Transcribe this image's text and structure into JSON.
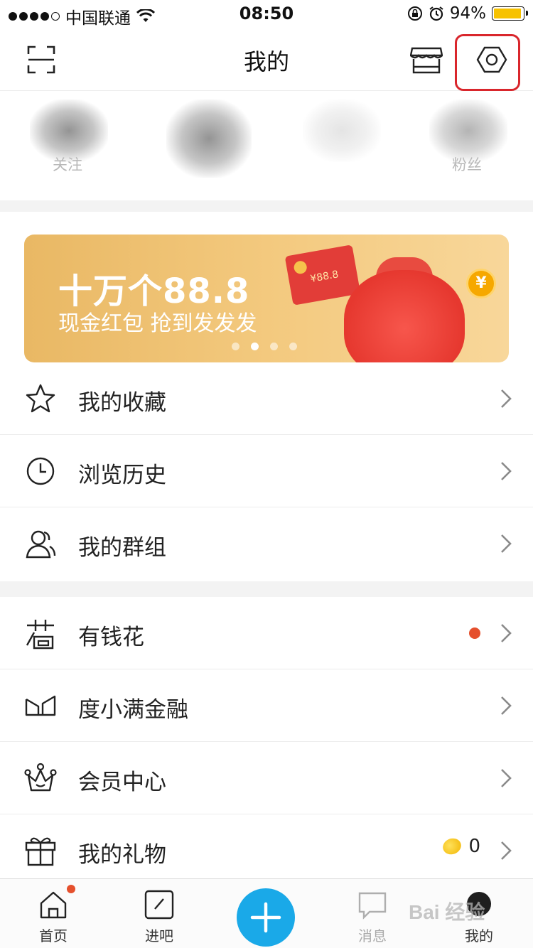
{
  "status_bar": {
    "carrier": "中国联通",
    "time": "08:50",
    "battery": "94%",
    "battery_level": 0.94
  },
  "nav": {
    "title": "我的",
    "icons": [
      "scan-icon",
      "shop-icon",
      "settings-icon"
    ]
  },
  "stats": [
    {
      "label": "关注"
    },
    {
      "label": ""
    },
    {
      "label": ""
    },
    {
      "label": "粉丝"
    }
  ],
  "banner": {
    "title": "十万个88.8",
    "subtitle": "现金红包 抢到发发发",
    "envelope_text": "¥88.8",
    "coin_symbol": "¥",
    "slide_count": 4,
    "active_slide": 2
  },
  "menu_group_1": [
    {
      "label": "我的收藏",
      "icon": "star-icon"
    },
    {
      "label": "浏览历史",
      "icon": "clock-icon"
    },
    {
      "label": "我的群组",
      "icon": "group-icon"
    }
  ],
  "menu_group_2": [
    {
      "label": "有钱花",
      "icon": "youqianhua-icon",
      "has_dot": true
    },
    {
      "label": "度小满金融",
      "icon": "finance-icon"
    },
    {
      "label": "会员中心",
      "icon": "crown-icon"
    },
    {
      "label": "我的礼物",
      "icon": "gift-icon",
      "count": "0"
    }
  ],
  "tab_bar": {
    "tabs": [
      {
        "label": "首页",
        "icon": "home-icon",
        "badge": true
      },
      {
        "label": "进吧",
        "icon": "enter-bar-icon"
      },
      {
        "label": "",
        "icon": "plus-icon"
      },
      {
        "label": "消息",
        "icon": "message-icon"
      },
      {
        "label": "我的",
        "icon": "avatar-icon"
      }
    ]
  },
  "watermark": "Bai 经验",
  "colors": {
    "accent": "#1aa9e8",
    "badge": "#e5502d",
    "highlight": "#d9262c",
    "banner": "#f3c97e"
  }
}
